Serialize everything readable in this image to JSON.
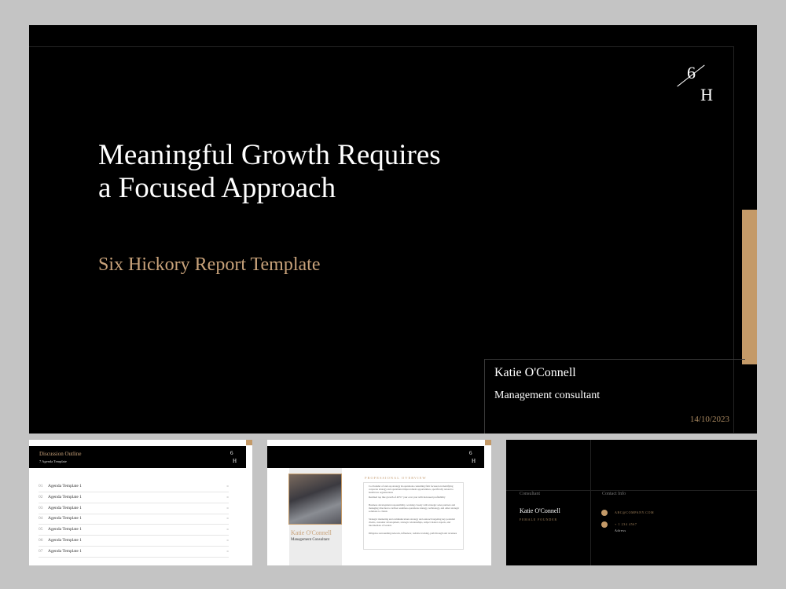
{
  "main": {
    "logo_top": "6",
    "logo_bottom": "H",
    "title": "Meaningful Growth Requires a Focused Approach",
    "subtitle": "Six Hickory Report Template",
    "name": "Katie O'Connell",
    "role": "Management consultant",
    "date": "14/10/2023"
  },
  "thumb1": {
    "title": "Discussion Outline",
    "subtitle": "7 Agenda Template",
    "logo_top": "6",
    "logo_bottom": "H",
    "rows": [
      {
        "num": "01",
        "label": "Agenda Template 1"
      },
      {
        "num": "02",
        "label": "Agenda Template 1"
      },
      {
        "num": "03",
        "label": "Agenda Template 1"
      },
      {
        "num": "04",
        "label": "Agenda Template 1"
      },
      {
        "num": "05",
        "label": "Agenda Template 1"
      },
      {
        "num": "06",
        "label": "Agenda Template 1"
      },
      {
        "num": "07",
        "label": "Agenda Template 1"
      }
    ]
  },
  "thumb2": {
    "logo_top": "6",
    "logo_bottom": "H",
    "name": "Katie O'Connell",
    "role": "Management Consultant",
    "overview_title": "PROFESSIONAL OVERVIEW",
    "bullets": [
      "Co-Founder of start-up strategy & operations consulting firm focused on identifying corporate strategy and operational improvement opportunities, specifically related to healthcare organizations",
      "Realized top line growth of 40%+ year over year with increased profitability",
      "Business development responsibility, working closely with strategic sales partners and managing direction to deliver seamless operations strategy, technology, and other strategic solutions to clients",
      "Strategic marketing and communications strategy and outreach targeting key potential clients, customer development, strategic relationships, subject matter experts, and intermediate of leaders",
      "Diligence surrounding network, influencer, website tracking, path through and revenues"
    ]
  },
  "thumb3": {
    "label_left": "Consultant",
    "label_right": "Contact Info",
    "name": "Katie O'Connell",
    "role": "FEMALE FOUNDER",
    "email": "ABC@COMPANY.COM",
    "phone": "+ 1 234 4567",
    "address": "Adress"
  }
}
